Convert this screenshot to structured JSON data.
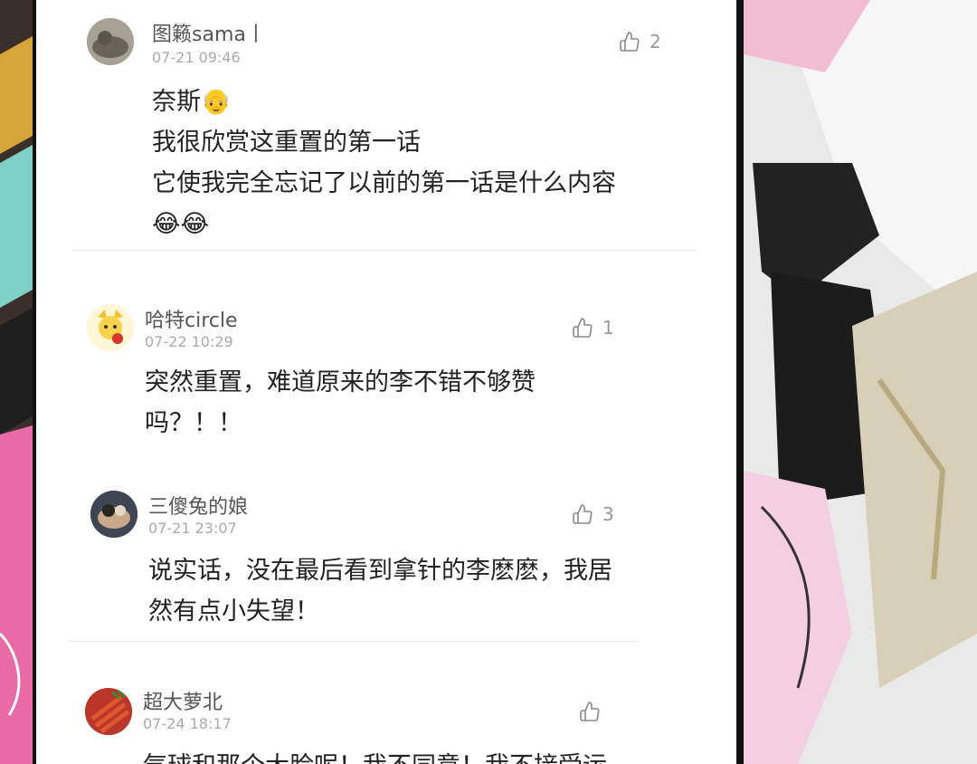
{
  "comments": [
    {
      "username": "图籁sama丨",
      "time": "07-21 09:46",
      "likes": "2",
      "lines": [
        "奈斯👴",
        "我很欣赏这重置的第一话",
        "它使我完全忘记了以前的第一话是什么内容",
        "😂😂"
      ]
    },
    {
      "username": "哈特circle",
      "time": "07-22 10:29",
      "likes": "1",
      "lines": [
        "突然重置，难道原来的李不错不够赞",
        "吗？！！"
      ]
    },
    {
      "username": "三傻兔的娘",
      "time": "07-21 23:07",
      "likes": "3",
      "lines": [
        "说实话，没在最后看到拿针的李麽麽，我居",
        "然有点小失望！"
      ]
    },
    {
      "username": "超大萝北",
      "time": "07-24 18:17",
      "likes": "",
      "lines": [
        "气球和那个大脸呢！我不同意！我不接受运"
      ]
    }
  ],
  "icons": {
    "like": "thumbs-up-icon"
  },
  "colors": {
    "text": "#222222",
    "meta": "#aaaaaa",
    "accent_art": "#e86aa6"
  }
}
